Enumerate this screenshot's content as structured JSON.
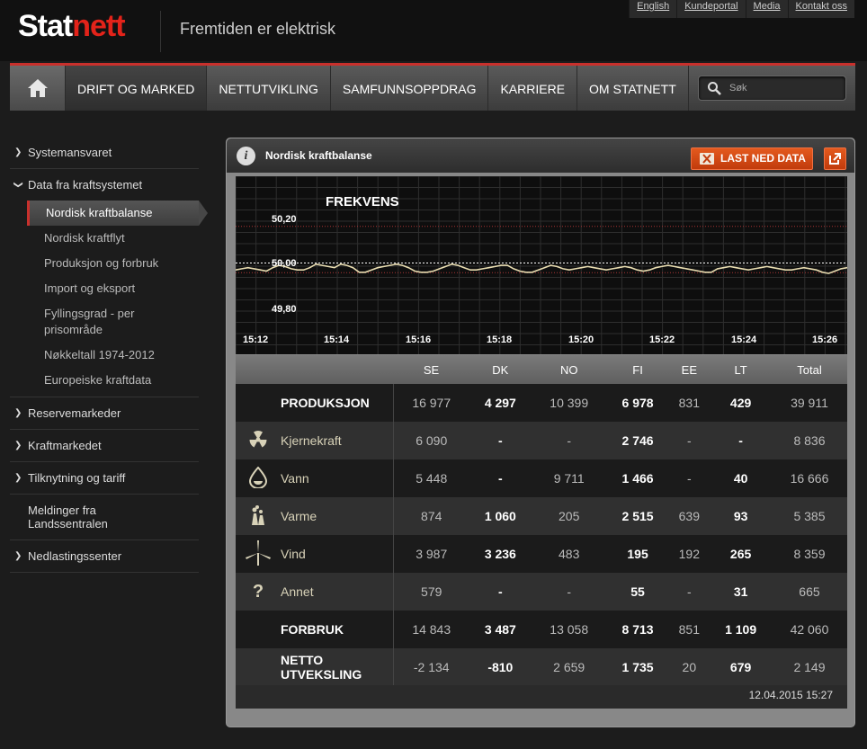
{
  "header": {
    "logo_prefix": "Stat",
    "logo_suffix": "nett",
    "tagline": "Fremtiden er elektrisk",
    "links": [
      "English",
      "Kundeportal",
      "Media",
      "Kontakt oss"
    ]
  },
  "nav": {
    "items": [
      "DRIFT OG MARKED",
      "NETTUTVIKLING",
      "SAMFUNNSOPPDRAG",
      "KARRIERE",
      "OM STATNETT"
    ],
    "search_placeholder": "Søk"
  },
  "sidebar": {
    "items": [
      {
        "label": "Systemansvaret"
      },
      {
        "label": "Data fra kraftsystemet"
      },
      {
        "label": "Reservemarkeder"
      },
      {
        "label": "Kraftmarkedet"
      },
      {
        "label": "Tilknytning og tariff"
      },
      {
        "label": "Meldinger fra Landssentralen"
      },
      {
        "label": "Nedlastingssenter"
      }
    ],
    "subitems": [
      "Nordisk kraftbalanse",
      "Nordisk kraftflyt",
      "Produksjon og forbruk",
      "Import og eksport",
      "Fyllingsgrad - per prisområde",
      "Nøkkeltall 1974-2012",
      "Europeiske kraftdata"
    ]
  },
  "panel": {
    "title": "Nordisk kraftbalanse",
    "download_label": "LAST NED DATA",
    "timestamp": "12.04.2015 15:27"
  },
  "chart_data": {
    "type": "line",
    "title": "FREKVENS",
    "ytick_labels": [
      "50,20",
      "50,00",
      "49,80"
    ],
    "xtick_labels": [
      "15:12",
      "15:14",
      "15:16",
      "15:18",
      "15:20",
      "15:22",
      "15:24",
      "15:26"
    ],
    "ylim": [
      49.8,
      50.2
    ],
    "reference_line": 50.0,
    "series": [
      {
        "values": [
          49.97,
          49.975,
          49.98,
          49.975,
          49.97,
          49.965,
          49.98,
          49.99,
          49.985,
          49.975,
          49.97,
          49.97,
          49.98,
          49.995,
          49.99,
          49.985,
          49.98,
          49.995,
          49.99,
          49.98,
          49.96,
          49.96,
          49.97,
          49.98,
          49.985,
          49.99,
          49.995,
          49.99,
          49.98,
          49.965,
          49.96,
          49.96,
          49.965,
          49.975,
          49.985,
          49.995,
          49.99,
          49.98,
          49.97,
          49.97,
          49.975,
          49.98,
          49.985,
          49.99,
          49.99,
          49.975,
          49.965,
          49.96,
          49.96,
          49.97,
          49.98,
          49.99,
          49.985,
          49.975,
          49.97,
          49.975,
          49.98,
          49.985,
          49.98,
          49.975,
          49.97,
          49.975,
          49.98,
          49.985,
          49.98,
          49.97,
          49.965,
          49.97,
          49.98,
          49.985,
          49.99,
          49.985,
          49.98,
          49.975,
          49.97,
          49.965,
          49.96,
          49.96,
          49.975,
          49.98,
          49.985,
          49.98,
          49.975,
          49.97,
          49.975,
          49.98,
          49.985,
          49.98,
          49.975,
          49.97,
          49.97,
          49.975,
          49.98,
          49.975,
          49.97,
          49.96,
          49.955,
          49.965,
          49.975,
          49.98
        ]
      }
    ]
  },
  "table": {
    "columns": [
      "SE",
      "DK",
      "NO",
      "FI",
      "EE",
      "LT",
      "Total"
    ],
    "rows": [
      {
        "icon": "none",
        "label": "PRODUKSJON",
        "values": [
          "16 977",
          "4 297",
          "10 399",
          "6 978",
          "831",
          "429",
          "39 911"
        ]
      },
      {
        "icon": "nuclear-icon",
        "label": "Kjernekraft",
        "values": [
          "6 090",
          "-",
          "-",
          "2 746",
          "-",
          "-",
          "8 836"
        ]
      },
      {
        "icon": "water-drop-icon",
        "label": "Vann",
        "values": [
          "5 448",
          "-",
          "9 711",
          "1 466",
          "-",
          "40",
          "16 666"
        ]
      },
      {
        "icon": "thermal-plant-icon",
        "label": "Varme",
        "values": [
          "874",
          "1 060",
          "205",
          "2 515",
          "639",
          "93",
          "5 385"
        ]
      },
      {
        "icon": "wind-turbine-icon",
        "label": "Vind",
        "values": [
          "3 987",
          "3 236",
          "483",
          "195",
          "192",
          "265",
          "8 359"
        ]
      },
      {
        "icon": "question-icon",
        "label": "Annet",
        "values": [
          "579",
          "-",
          "-",
          "55",
          "-",
          "31",
          "665"
        ]
      },
      {
        "icon": "none",
        "label": "FORBRUK",
        "values": [
          "14 843",
          "3 487",
          "13 058",
          "8 713",
          "851",
          "1 109",
          "42 060"
        ]
      },
      {
        "icon": "none",
        "label": "NETTO UTVEKSLING",
        "values": [
          "-2 134",
          "-810",
          "2 659",
          "1 735",
          "20",
          "679",
          "2 149"
        ]
      }
    ]
  }
}
